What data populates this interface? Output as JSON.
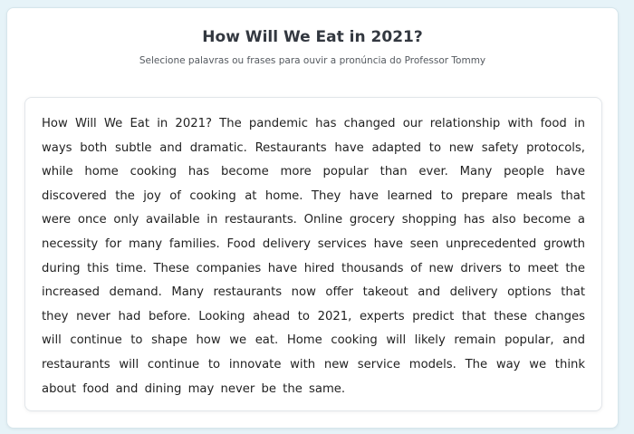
{
  "header": {
    "title": "How Will We Eat in 2021?",
    "subtitle": "Selecione palavras ou frases para ouvir a pronúncia do Professor Tommy"
  },
  "reading": {
    "text": "How Will We Eat in 2021? The pandemic has changed our relationship with food in ways both subtle and dramatic. Restaurants have adapted to new safety protocols, while home cooking has become more popular than ever. Many people have discovered the joy of cooking at home. They have learned to prepare meals that were once only available in restaurants. Online grocery shopping has also become a necessity for many families. Food delivery services have seen unprecedented growth during this time. These companies have hired thousands of new drivers to meet the increased demand. Many restaurants now offer takeout and delivery options that they never had before. Looking ahead to 2021, experts predict that these changes will continue to shape how we eat. Home cooking will likely remain popular, and restaurants will continue to innovate with new service models. The way we think about food and dining may never be the same."
  }
}
